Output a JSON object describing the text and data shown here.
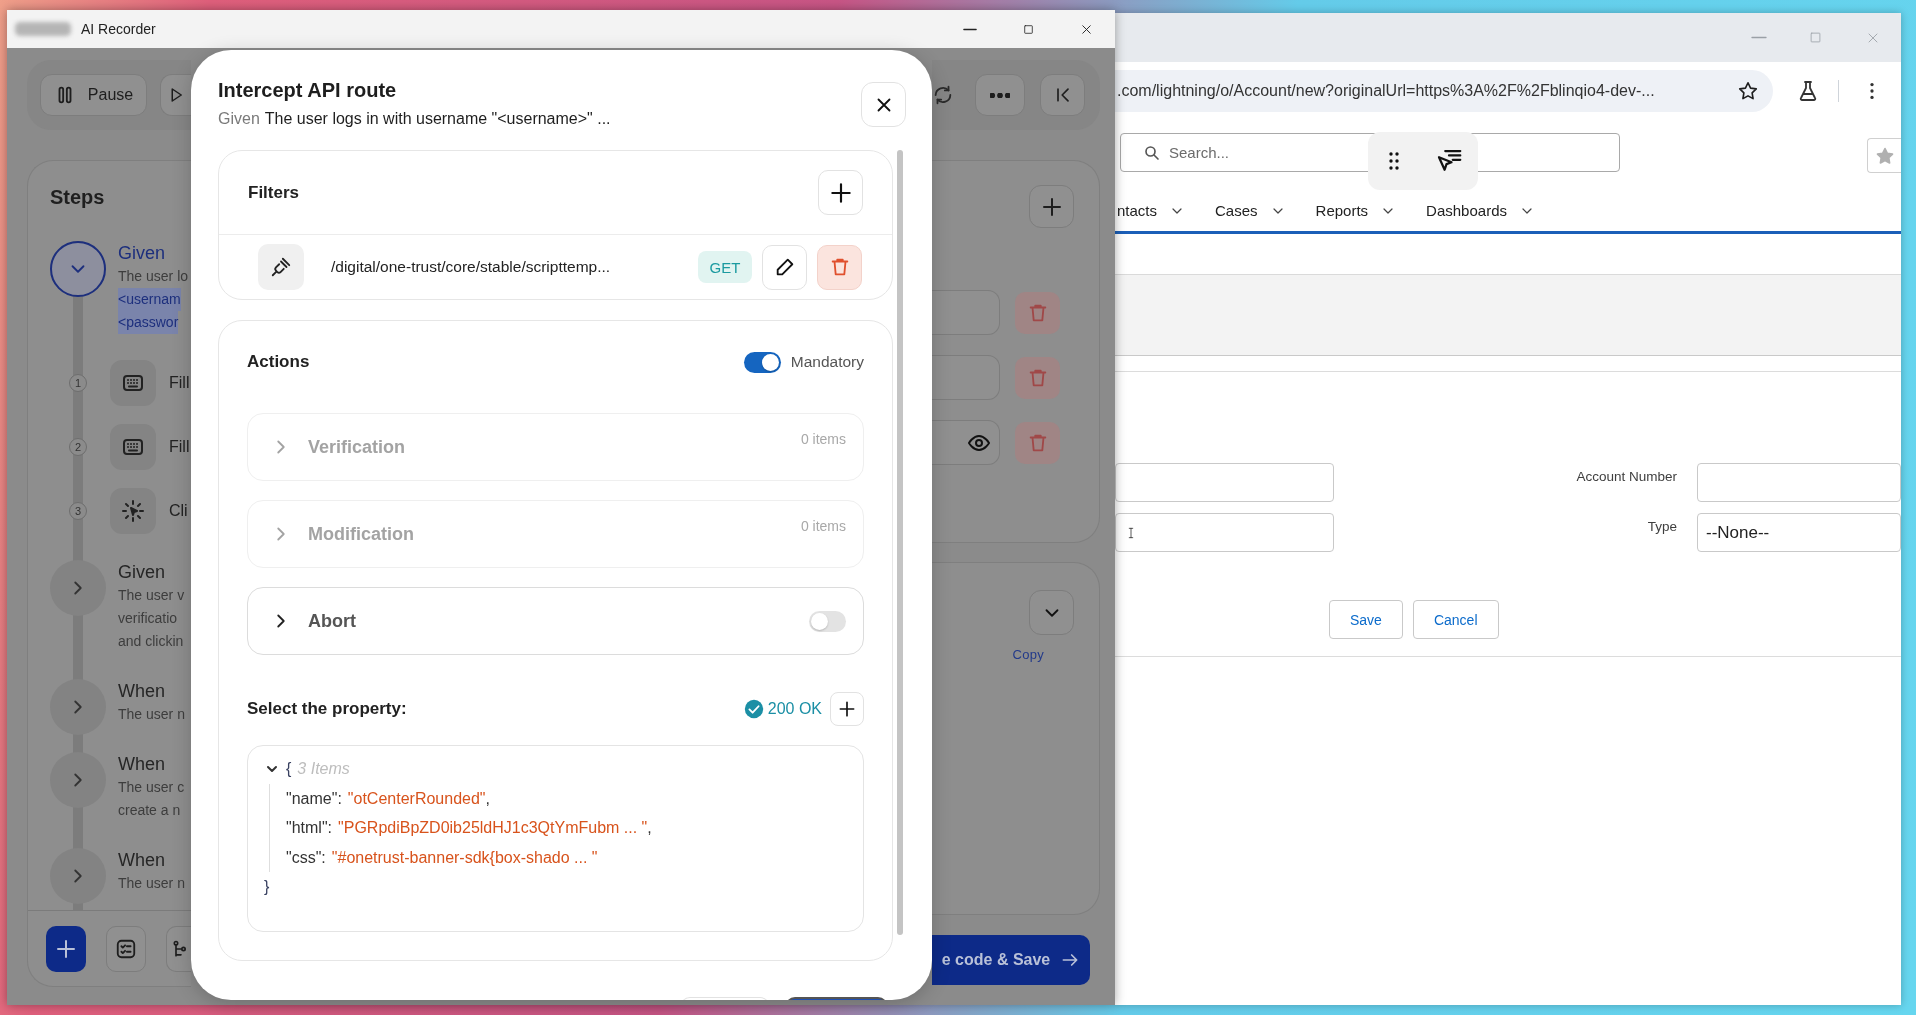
{
  "recorder": {
    "title": "AI Recorder",
    "pause": "Pause",
    "steps_title": "Steps",
    "steps": [
      {
        "keyword": "Given",
        "expanded": true,
        "lines": [
          {
            "text": "The user lo",
            "highlighted": false
          },
          {
            "text": "<usernam",
            "highlighted": true
          },
          {
            "text": "<passwor",
            "highlighted": true
          }
        ],
        "substeps": [
          {
            "number": "1",
            "kind": "keyboard",
            "label": "Fill"
          },
          {
            "number": "2",
            "kind": "keyboard",
            "label": "Fill"
          },
          {
            "number": "3",
            "kind": "click",
            "label": "Cli"
          }
        ]
      },
      {
        "keyword": "Given",
        "expanded": false,
        "lines": [
          {
            "text": "The user v",
            "highlighted": false
          },
          {
            "text": "verificatio",
            "highlighted": false
          },
          {
            "text": "and clickin",
            "highlighted": false
          }
        ]
      },
      {
        "keyword": "When",
        "expanded": false,
        "lines": [
          {
            "text": "The user n",
            "highlighted": false
          }
        ]
      },
      {
        "keyword": "When",
        "expanded": false,
        "lines": [
          {
            "text": "The user c",
            "highlighted": false
          },
          {
            "text": "create a n",
            "highlighted": false
          }
        ]
      },
      {
        "keyword": "When",
        "expanded": false,
        "lines": [
          {
            "text": "The user n",
            "highlighted": false
          }
        ]
      }
    ],
    "field_rows": [
      {
        "kind": "plain"
      },
      {
        "kind": "plain"
      },
      {
        "kind": "secret"
      }
    ],
    "copy": "Copy",
    "save": "e code & Save"
  },
  "modal": {
    "title": "Intercept API route",
    "step_keyword": "Given",
    "step_text": "The user logs in with username \"<username>\" ...",
    "filters": {
      "title": "Filters",
      "items": [
        {
          "path": "/digital/one-trust/core/stable/scripttemp...",
          "method": "GET"
        }
      ]
    },
    "actions": {
      "title": "Actions",
      "mandatory": {
        "label": "Mandatory",
        "on": true
      },
      "sections": [
        {
          "kind": "count",
          "label": "Verification",
          "count": "0 items",
          "disabled": true
        },
        {
          "kind": "count",
          "label": "Modification",
          "count": "0 items",
          "disabled": true
        },
        {
          "kind": "toggle",
          "label": "Abort",
          "on": false,
          "disabled": false
        }
      ]
    },
    "property": {
      "label": "Select the property:",
      "status": "200 OK",
      "json": {
        "expanded": true,
        "open": "{",
        "summary": "3 Items",
        "close": "}",
        "entries": [
          {
            "key": "\"name\":",
            "value": "\"otCenterRounded\"",
            "punct": ","
          },
          {
            "key": "\"html\":",
            "value": "\"PGRpdiBpZD0ib25ldHJ1c3QtYmFubm ... \"",
            "punct": ","
          },
          {
            "key": "\"css\":",
            "value": "\"#onetrust-banner-sdk{box-shado ... \""
          }
        ]
      }
    },
    "footer_buttons": [
      {
        "kind": "secondary"
      },
      {
        "kind": "primary"
      }
    ]
  },
  "browser": {
    "url": ".com/lightning/o/Account/new?originalUrl=https%3A%2F%2Fblinqio4-dev-...",
    "search": {
      "placeholder": "Search..."
    },
    "nav": [
      {
        "label": "ntacts"
      },
      {
        "label": "Cases"
      },
      {
        "label": "Reports"
      },
      {
        "label": "Dashboards"
      }
    ],
    "form": {
      "rows": [
        {
          "kind": "text",
          "label": "Account Number"
        },
        {
          "kind": "select",
          "label": "Type",
          "value": "--None--"
        }
      ],
      "buttons": [
        "Save",
        "Cancel"
      ]
    }
  }
}
